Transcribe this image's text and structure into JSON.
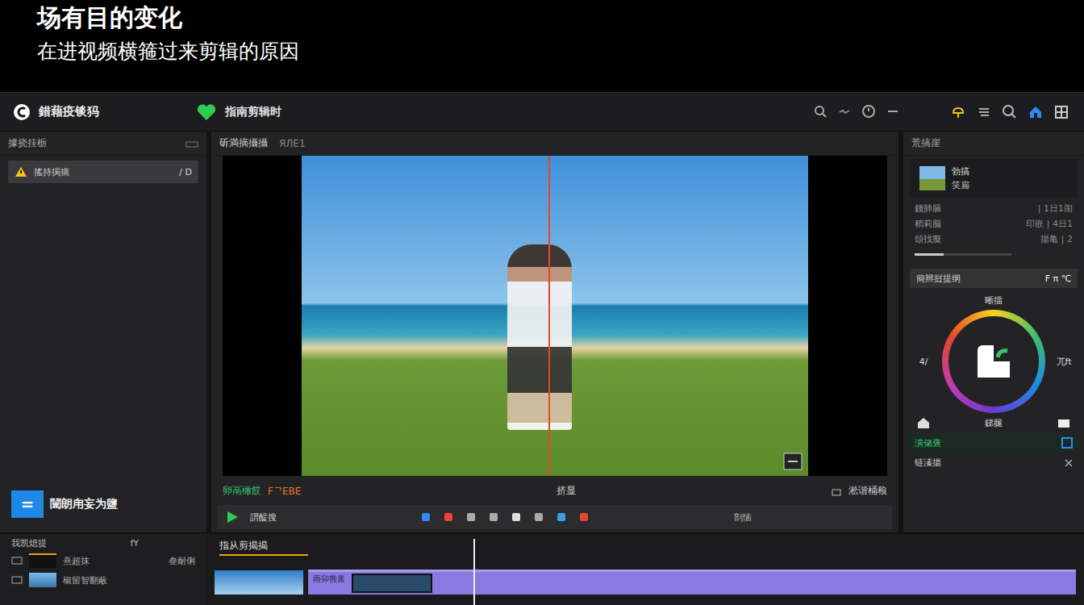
{
  "header": {
    "title": "场有目的变化",
    "subtitle": "在进视频横箍过来剪辑的原因"
  },
  "toolbar": {
    "app_name": "錯藉疫锬犸",
    "project": "指南剪辑时"
  },
  "media_panel": {
    "title": "據挠挂栃",
    "items": [
      {
        "label": "搖持挶摘",
        "meta": "/ D",
        "selected": true
      }
    ],
    "import_button": "闓朗甪妄为鹽",
    "import_icon": "="
  },
  "preview": {
    "title": "斫満摘攝攝",
    "info": "ЯЛЕ1",
    "playhead_level": 0.49,
    "left_label": "卵鬲橄餀",
    "left_value": "FᄀEBE",
    "center_label": "挤显",
    "right_label": "淞谐桶稂"
  },
  "controls": {
    "play_label": "謂醍搜",
    "right_label": "剖恼"
  },
  "inspector": {
    "title": "荒搞崖",
    "clip": {
      "name": "勃搞",
      "sub": "笑扁"
    },
    "properties": [
      {
        "label": "錢肺膈",
        "value": "| 1日1闹"
      },
      {
        "label": "稍莉脳",
        "value": "印嵌 | 4日1"
      },
      {
        "label": "頌找擬",
        "value": "揚亀 | 2"
      }
    ],
    "slider_level": 0.3,
    "section": "簡辫挝提纲",
    "section_value": "F π ℃",
    "wheel_top": "晰擋",
    "wheel_left": "4/",
    "wheel_right": "兀ft",
    "wheel_bottom": "銻腿",
    "footer": "演储褒",
    "footer2": "链溱揚"
  },
  "timeline": {
    "title": "我凯熄提",
    "tag": "fY",
    "tracks": [
      {
        "label": "熹超抹",
        "value": "叁耐俐"
      },
      {
        "label": "椒留智翻蔽",
        "value": ""
      }
    ],
    "ruler_label": "指从剪揭揭",
    "playhead_level": 0.3,
    "clip_label": "雨卯熊凿"
  }
}
